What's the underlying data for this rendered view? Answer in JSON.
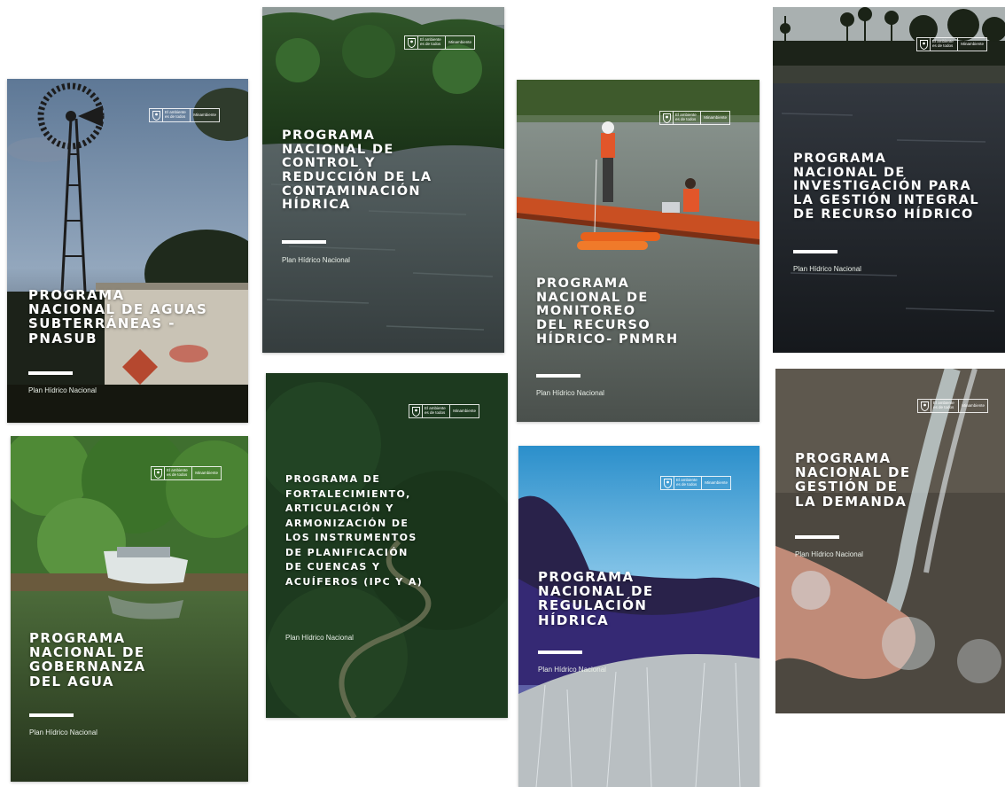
{
  "brand": {
    "slogan": "El ambiente\nes de todos",
    "ministry": "Minambiente",
    "crest": "coat-of-arms-icon"
  },
  "footer_label": "Plan Hídrico Nacional",
  "covers": [
    {
      "id": "aguas-subterraneas",
      "title": "PROGRAMA\nNACIONAL DE AGUAS\nSUBTERRÁNEAS -\nPNASUB",
      "subtitle": "Plan Hídrico Nacional"
    },
    {
      "id": "control-contaminacion",
      "title": "PROGRAMA\nNACIONAL DE\nCONTROL Y\nREDUCCIÓN DE LA\nCONTAMINACIÓN\nHÍDRICA",
      "subtitle": "Plan Hídrico Nacional"
    },
    {
      "id": "monitoreo",
      "title": "PROGRAMA\nNACIONAL DE\nMONITOREO\nDEL RECURSO\nHÍDRICO- PNMRH",
      "subtitle": "Plan Hídrico Nacional"
    },
    {
      "id": "investigacion",
      "title": "PROGRAMA\nNACIONAL DE\nINVESTIGACIÓN PARA\nLA GESTIÓN INTEGRAL\nDE RECURSO HÍDRICO",
      "subtitle": "Plan Hídrico Nacional"
    },
    {
      "id": "gobernanza",
      "title": "PROGRAMA\nNACIONAL DE\nGOBERNANZA\nDEL AGUA",
      "subtitle": "Plan Hídrico Nacional"
    },
    {
      "id": "fortalecimiento",
      "title": "PROGRAMA DE\nFORTALECIMIENTO,\nARTICULACIÓN Y\nARMONIZACIÓN DE\nLOS INSTRUMENTOS\nDE PLANIFICACIÓN\nDE CUENCAS Y\nACUÍFEROS (IPC Y A)",
      "subtitle": "Plan Hídrico Nacional"
    },
    {
      "id": "regulacion",
      "title": "PROGRAMA\nNACIONAL DE\nREGULACIÓN\nHÍDRICA",
      "subtitle": "Plan Hídrico Nacional"
    },
    {
      "id": "demanda",
      "title": "PROGRAMA\nNACIONAL DE\nGESTIÓN DE\nLA DEMANDA",
      "subtitle": "Plan Hídrico Nacional"
    }
  ]
}
